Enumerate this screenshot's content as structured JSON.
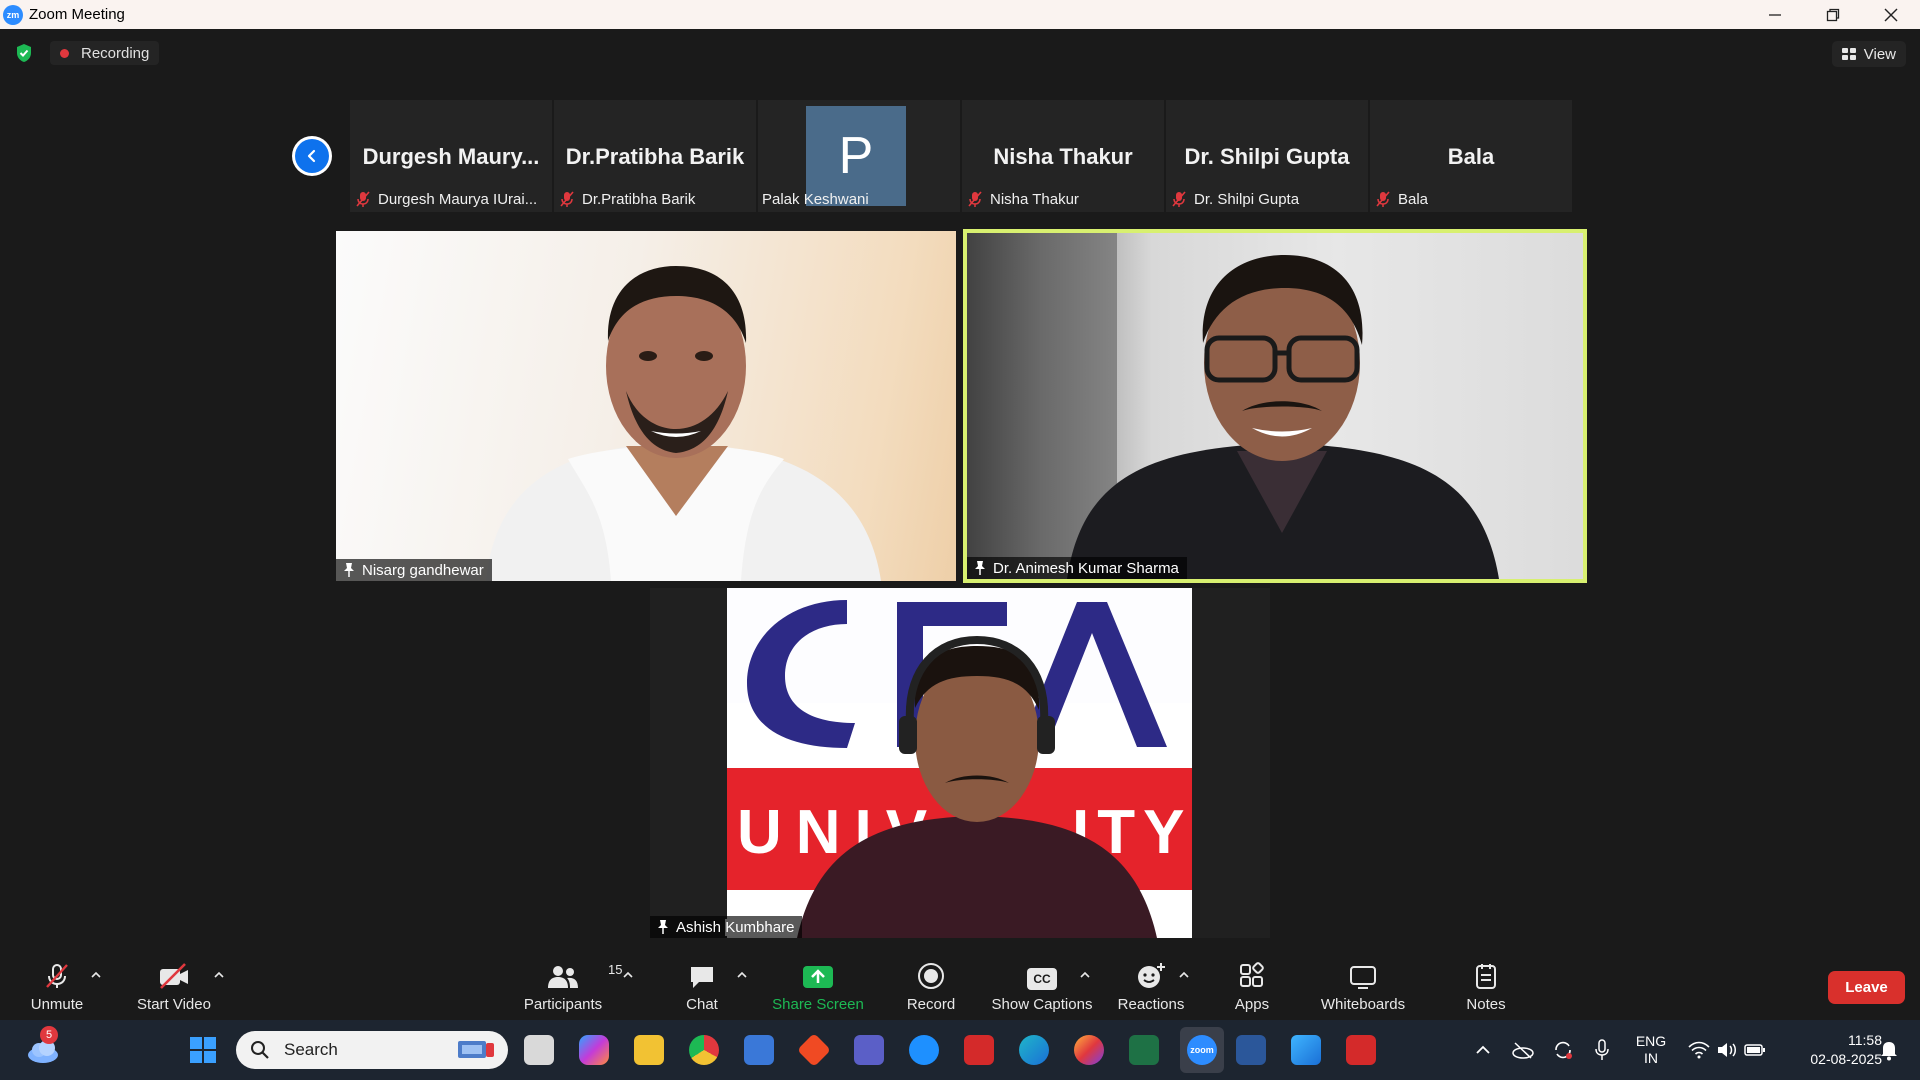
{
  "window": {
    "title": "Zoom Meeting",
    "logo": "zm"
  },
  "topbar": {
    "recording_label": "Recording",
    "view_label": "View"
  },
  "thumbnails": [
    {
      "display": "Durgesh  Maury...",
      "label": "Durgesh Maurya IUrai...",
      "muted": true
    },
    {
      "display": "Dr.Pratibha Barik",
      "label": "Dr.Pratibha Barik",
      "muted": true
    },
    {
      "display": "P",
      "label": "Palak Keshwani",
      "muted": false
    },
    {
      "display": "Nisha Thakur",
      "label": "Nisha Thakur",
      "muted": true
    },
    {
      "display": "Dr. Shilpi Gupta",
      "label": "Dr. Shilpi Gupta",
      "muted": true
    },
    {
      "display": "Bala",
      "label": "Bala",
      "muted": true
    }
  ],
  "tiles": [
    {
      "name": "Nisarg gandhewar"
    },
    {
      "name": "Dr. Animesh Kumar Sharma"
    },
    {
      "name_pre": "Ashish ",
      "name_highlight": "Kumbhare"
    }
  ],
  "toolbar": {
    "unmute": "Unmute",
    "start_video": "Start Video",
    "participants": "Participants",
    "participants_count": "15",
    "chat": "Chat",
    "share_screen": "Share Screen",
    "record": "Record",
    "show_captions": "Show Captions",
    "captions_icon_text": "CC",
    "reactions": "Reactions",
    "apps": "Apps",
    "whiteboards": "Whiteboards",
    "notes": "Notes",
    "leave": "Leave"
  },
  "taskbar": {
    "search_placeholder": "Search",
    "weather_badge": "5",
    "language_line1": "ENG",
    "language_line2": "IN",
    "time": "11:58",
    "date": "02-08-2025",
    "zoom_label": "zoom"
  },
  "colors": {
    "accent_blue": "#0e72ed",
    "share_green": "#1db954",
    "leave_red": "#d9302c",
    "active_speaker": "#d8f070",
    "mute_red": "#e0383e"
  }
}
